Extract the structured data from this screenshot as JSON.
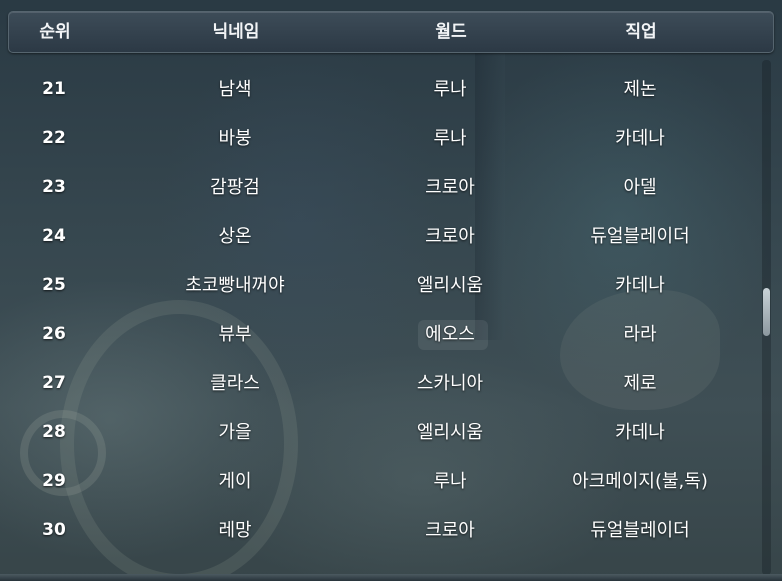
{
  "table": {
    "headers": {
      "rank": "순위",
      "nickname": "닉네임",
      "world": "월드",
      "job": "직업"
    },
    "rows": [
      {
        "rank": "21",
        "nickname": "남색",
        "world": "루나",
        "job": "제논"
      },
      {
        "rank": "22",
        "nickname": "바붕",
        "world": "루나",
        "job": "카데나"
      },
      {
        "rank": "23",
        "nickname": "감팡검",
        "world": "크로아",
        "job": "아델"
      },
      {
        "rank": "24",
        "nickname": "상온",
        "world": "크로아",
        "job": "듀얼블레이더"
      },
      {
        "rank": "25",
        "nickname": "초코빵내꺼야",
        "world": "엘리시움",
        "job": "카데나"
      },
      {
        "rank": "26",
        "nickname": "뷰부",
        "world": "에오스",
        "job": "라라"
      },
      {
        "rank": "27",
        "nickname": "클라스",
        "world": "스카니아",
        "job": "제로"
      },
      {
        "rank": "28",
        "nickname": "가을",
        "world": "엘리시움",
        "job": "카데나"
      },
      {
        "rank": "29",
        "nickname": "게이",
        "world": "루나",
        "job": "아크메이지(불,독)"
      },
      {
        "rank": "30",
        "nickname": "레망",
        "world": "크로아",
        "job": "듀얼블레이더"
      }
    ]
  },
  "scroll": {
    "position_fraction": 0.47
  },
  "colors": {
    "header_bg": "#34424e",
    "text": "#ffffff",
    "background": "#36474f"
  }
}
